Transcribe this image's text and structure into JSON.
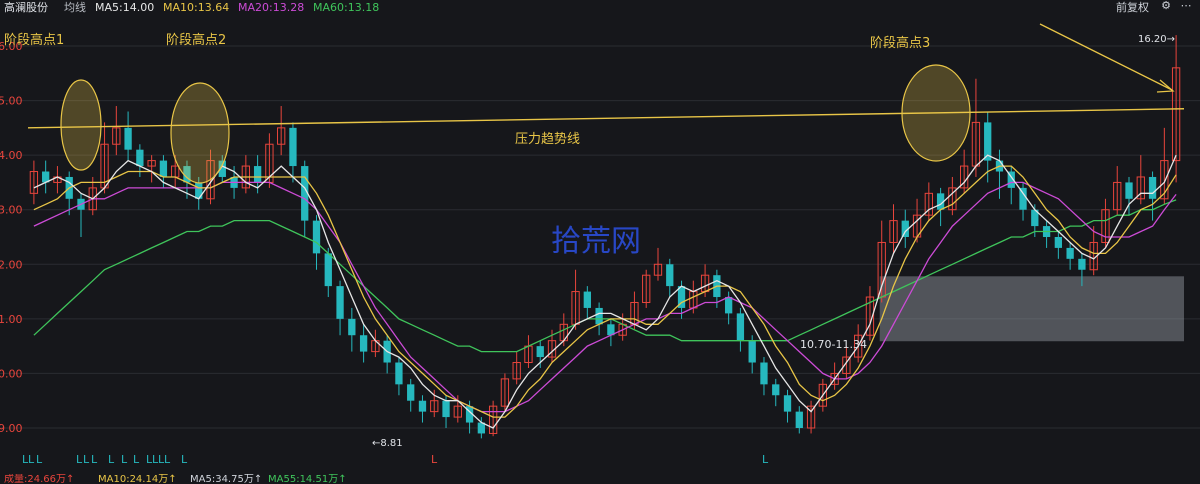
{
  "topbar": {
    "stock_name": "高澜股份",
    "avg_line": "均线",
    "ma5": "MA5:14.00",
    "ma10": "MA10:13.64",
    "ma20": "MA20:13.28",
    "ma60": "MA60:13.18",
    "adjust": "前复权"
  },
  "bottombar": {
    "vol": "成量:24.66万↑",
    "ma10v": "MA10:24.14万↑",
    "ma5v": "MA5:34.75万↑",
    "ma55v": "MA55:14.51万↑"
  },
  "colors": {
    "bg": "#16171b",
    "up": "#e8453c",
    "down": "#26b8be",
    "ma5": "#e6e6e6",
    "ma10": "#e8c547",
    "ma20": "#cc4bd6",
    "ma60": "#3fc45b",
    "trendline": "#e8c547",
    "watermark": "#2b4dd8"
  },
  "chart_data": {
    "type": "candlestick",
    "y_ticks": [
      "6.00",
      "5.00",
      "4.00",
      "3.00",
      "2.00",
      "1.00",
      "0.00",
      "9.00"
    ],
    "annotations": {
      "peak1": "阶段高点1",
      "peak2": "阶段高点2",
      "peak3": "阶段高点3",
      "trendline_label": "压力趋势线",
      "high_label": "16.20→",
      "low_label": "←8.81",
      "support_zone_label": "10.70-11.34",
      "watermark": "拾荒网"
    },
    "support_zone": [
      10.7,
      11.34
    ],
    "high": 16.2,
    "low": 8.81,
    "ma_lines": {
      "ma5": [
        13.4,
        13.5,
        13.6,
        13.5,
        13.3,
        13.2,
        13.4,
        13.7,
        13.9,
        13.8,
        13.7,
        13.5,
        13.4,
        13.3,
        13.2,
        13.5,
        13.8,
        13.7,
        13.5,
        13.4,
        13.6,
        13.8,
        13.6,
        13.4,
        13.0,
        12.4,
        11.9,
        11.4,
        10.9,
        10.6,
        10.4,
        10.3,
        10.1,
        9.8,
        9.6,
        9.5,
        9.5,
        9.3,
        9.1,
        9.0,
        9.3,
        9.7,
        10.0,
        10.2,
        10.4,
        10.6,
        10.9,
        11.0,
        11.1,
        11.1,
        11.0,
        10.9,
        10.8,
        11.0,
        11.4,
        11.6,
        11.5,
        11.6,
        11.7,
        11.6,
        11.3,
        10.9,
        10.5,
        10.1,
        9.8,
        9.5,
        9.3,
        9.6,
        9.9,
        10.2,
        10.5,
        10.9,
        11.6,
        12.2,
        12.6,
        12.8,
        13.0,
        13.1,
        13.3,
        13.5,
        13.8,
        14.0,
        13.9,
        13.6,
        13.3,
        13.0,
        12.8,
        12.6,
        12.4,
        12.2,
        12.1,
        12.3,
        12.7,
        13.1,
        13.3,
        13.3,
        13.5,
        14.0
      ],
      "ma10": [
        13.0,
        13.1,
        13.2,
        13.4,
        13.5,
        13.5,
        13.5,
        13.6,
        13.7,
        13.7,
        13.7,
        13.6,
        13.6,
        13.5,
        13.4,
        13.4,
        13.5,
        13.6,
        13.6,
        13.6,
        13.6,
        13.6,
        13.6,
        13.6,
        13.3,
        12.9,
        12.4,
        11.9,
        11.4,
        11.0,
        10.7,
        10.4,
        10.2,
        10.0,
        9.8,
        9.6,
        9.5,
        9.4,
        9.3,
        9.2,
        9.2,
        9.4,
        9.7,
        9.9,
        10.2,
        10.4,
        10.6,
        10.8,
        10.9,
        11.0,
        11.0,
        11.0,
        10.9,
        10.9,
        11.1,
        11.3,
        11.4,
        11.5,
        11.6,
        11.6,
        11.5,
        11.2,
        10.9,
        10.5,
        10.2,
        9.8,
        9.6,
        9.5,
        9.6,
        9.8,
        10.1,
        10.5,
        11.0,
        11.6,
        12.1,
        12.5,
        12.8,
        13.0,
        13.1,
        13.3,
        13.5,
        13.7,
        13.8,
        13.8,
        13.6,
        13.3,
        13.0,
        12.8,
        12.5,
        12.3,
        12.2,
        12.2,
        12.4,
        12.7,
        13.0,
        13.1,
        13.3,
        13.64
      ],
      "ma20": [
        12.7,
        12.8,
        12.9,
        13.0,
        13.1,
        13.2,
        13.2,
        13.3,
        13.4,
        13.4,
        13.4,
        13.4,
        13.4,
        13.4,
        13.4,
        13.4,
        13.5,
        13.5,
        13.5,
        13.5,
        13.5,
        13.4,
        13.3,
        13.2,
        13.0,
        12.7,
        12.4,
        12.0,
        11.6,
        11.2,
        10.9,
        10.6,
        10.3,
        10.1,
        9.9,
        9.7,
        9.5,
        9.4,
        9.3,
        9.3,
        9.3,
        9.4,
        9.5,
        9.7,
        9.9,
        10.1,
        10.3,
        10.5,
        10.6,
        10.7,
        10.8,
        10.9,
        11.0,
        11.0,
        11.1,
        11.1,
        11.2,
        11.3,
        11.3,
        11.4,
        11.3,
        11.2,
        11.0,
        10.8,
        10.6,
        10.4,
        10.2,
        10.0,
        9.9,
        9.9,
        10.0,
        10.2,
        10.5,
        10.9,
        11.3,
        11.7,
        12.1,
        12.4,
        12.7,
        12.9,
        13.1,
        13.3,
        13.4,
        13.5,
        13.5,
        13.4,
        13.3,
        13.2,
        13.0,
        12.8,
        12.6,
        12.5,
        12.5,
        12.5,
        12.6,
        12.7,
        13.0,
        13.28
      ],
      "ma60": [
        10.7,
        10.9,
        11.1,
        11.3,
        11.5,
        11.7,
        11.9,
        12.0,
        12.1,
        12.2,
        12.3,
        12.4,
        12.5,
        12.6,
        12.6,
        12.7,
        12.7,
        12.8,
        12.8,
        12.8,
        12.8,
        12.7,
        12.6,
        12.5,
        12.4,
        12.2,
        12.0,
        11.8,
        11.6,
        11.4,
        11.2,
        11.0,
        10.9,
        10.8,
        10.7,
        10.6,
        10.5,
        10.5,
        10.4,
        10.4,
        10.4,
        10.4,
        10.5,
        10.6,
        10.7,
        10.8,
        10.9,
        11.0,
        11.0,
        11.0,
        10.9,
        10.8,
        10.7,
        10.7,
        10.7,
        10.6,
        10.6,
        10.6,
        10.6,
        10.6,
        10.6,
        10.6,
        10.6,
        10.6,
        10.6,
        10.7,
        10.8,
        10.9,
        11.0,
        11.1,
        11.2,
        11.3,
        11.4,
        11.5,
        11.6,
        11.7,
        11.8,
        11.9,
        12.0,
        12.1,
        12.2,
        12.3,
        12.4,
        12.5,
        12.5,
        12.6,
        12.6,
        12.6,
        12.7,
        12.7,
        12.8,
        12.8,
        12.9,
        12.9,
        13.0,
        13.0,
        13.1,
        13.18
      ]
    },
    "candles": [
      [
        13.3,
        13.7,
        13.9,
        13.1
      ],
      [
        13.7,
        13.5,
        13.9,
        13.3
      ],
      [
        13.5,
        13.6,
        13.8,
        13.3
      ],
      [
        13.6,
        13.2,
        13.7,
        12.9
      ],
      [
        13.2,
        13.0,
        13.3,
        12.5
      ],
      [
        13.0,
        13.4,
        13.6,
        12.9
      ],
      [
        13.4,
        14.2,
        14.6,
        13.3
      ],
      [
        14.2,
        14.5,
        14.9,
        14.0
      ],
      [
        14.5,
        14.1,
        14.8,
        13.9
      ],
      [
        14.1,
        13.8,
        14.2,
        13.6
      ],
      [
        13.8,
        13.9,
        14.0,
        13.5
      ],
      [
        13.9,
        13.6,
        14.0,
        13.4
      ],
      [
        13.6,
        13.8,
        14.0,
        13.4
      ],
      [
        13.8,
        13.5,
        13.9,
        13.2
      ],
      [
        13.5,
        13.2,
        13.6,
        13.0
      ],
      [
        13.2,
        13.9,
        14.1,
        13.1
      ],
      [
        13.9,
        13.6,
        14.0,
        13.5
      ],
      [
        13.6,
        13.4,
        13.8,
        13.2
      ],
      [
        13.4,
        13.8,
        14.0,
        13.3
      ],
      [
        13.8,
        13.5,
        14.0,
        13.3
      ],
      [
        13.5,
        14.2,
        14.4,
        13.4
      ],
      [
        14.2,
        14.5,
        14.9,
        14.0
      ],
      [
        14.5,
        13.8,
        14.6,
        13.5
      ],
      [
        13.8,
        12.8,
        13.9,
        12.5
      ],
      [
        12.8,
        12.2,
        12.9,
        11.9
      ],
      [
        12.2,
        11.6,
        12.3,
        11.4
      ],
      [
        11.6,
        11.0,
        11.7,
        10.7
      ],
      [
        11.0,
        10.7,
        11.2,
        10.4
      ],
      [
        10.7,
        10.4,
        10.9,
        10.2
      ],
      [
        10.4,
        10.6,
        10.8,
        10.3
      ],
      [
        10.6,
        10.2,
        10.7,
        10.0
      ],
      [
        10.2,
        9.8,
        10.3,
        9.6
      ],
      [
        9.8,
        9.5,
        9.9,
        9.3
      ],
      [
        9.5,
        9.3,
        9.6,
        9.1
      ],
      [
        9.3,
        9.5,
        9.7,
        9.2
      ],
      [
        9.5,
        9.2,
        9.6,
        9.0
      ],
      [
        9.2,
        9.4,
        9.6,
        9.1
      ],
      [
        9.4,
        9.1,
        9.5,
        8.9
      ],
      [
        9.1,
        8.9,
        9.2,
        8.81
      ],
      [
        8.9,
        9.4,
        9.5,
        8.85
      ],
      [
        9.4,
        9.9,
        10.0,
        9.3
      ],
      [
        9.9,
        10.2,
        10.4,
        9.8
      ],
      [
        10.2,
        10.5,
        10.7,
        10.1
      ],
      [
        10.5,
        10.3,
        10.6,
        10.1
      ],
      [
        10.3,
        10.6,
        10.8,
        10.2
      ],
      [
        10.6,
        10.9,
        11.1,
        10.5
      ],
      [
        10.9,
        11.5,
        11.9,
        10.8
      ],
      [
        11.5,
        11.2,
        11.6,
        11.0
      ],
      [
        11.2,
        10.9,
        11.3,
        10.7
      ],
      [
        10.9,
        10.7,
        11.0,
        10.5
      ],
      [
        10.7,
        10.9,
        11.1,
        10.6
      ],
      [
        10.9,
        11.3,
        11.5,
        10.8
      ],
      [
        11.3,
        11.8,
        11.9,
        11.2
      ],
      [
        11.8,
        12.0,
        12.3,
        11.7
      ],
      [
        12.0,
        11.6,
        12.1,
        11.4
      ],
      [
        11.6,
        11.2,
        11.7,
        11.0
      ],
      [
        11.2,
        11.5,
        11.7,
        11.1
      ],
      [
        11.5,
        11.8,
        12.0,
        11.4
      ],
      [
        11.8,
        11.4,
        11.9,
        11.2
      ],
      [
        11.4,
        11.1,
        11.5,
        10.9
      ],
      [
        11.1,
        10.6,
        11.2,
        10.4
      ],
      [
        10.6,
        10.2,
        10.7,
        10.0
      ],
      [
        10.2,
        9.8,
        10.3,
        9.6
      ],
      [
        9.8,
        9.6,
        9.9,
        9.4
      ],
      [
        9.6,
        9.3,
        9.7,
        9.1
      ],
      [
        9.3,
        9.0,
        9.4,
        8.9
      ],
      [
        9.0,
        9.4,
        9.5,
        8.9
      ],
      [
        9.4,
        9.8,
        9.9,
        9.3
      ],
      [
        9.8,
        10.0,
        10.2,
        9.7
      ],
      [
        10.0,
        10.3,
        10.5,
        9.9
      ],
      [
        10.3,
        10.7,
        10.9,
        10.2
      ],
      [
        10.7,
        11.4,
        11.6,
        10.6
      ],
      [
        11.4,
        12.4,
        12.8,
        11.3
      ],
      [
        12.4,
        12.8,
        13.1,
        12.2
      ],
      [
        12.8,
        12.5,
        13.0,
        12.3
      ],
      [
        12.5,
        12.9,
        13.2,
        12.4
      ],
      [
        12.9,
        13.3,
        13.5,
        12.8
      ],
      [
        13.3,
        13.0,
        13.4,
        12.7
      ],
      [
        13.0,
        13.4,
        13.6,
        12.9
      ],
      [
        13.4,
        13.8,
        14.1,
        13.3
      ],
      [
        13.8,
        14.6,
        15.4,
        13.6
      ],
      [
        14.6,
        13.9,
        14.8,
        13.5
      ],
      [
        13.9,
        13.7,
        14.1,
        13.2
      ],
      [
        13.7,
        13.4,
        13.8,
        13.1
      ],
      [
        13.4,
        13.0,
        13.5,
        12.8
      ],
      [
        13.0,
        12.7,
        13.1,
        12.5
      ],
      [
        12.7,
        12.5,
        12.8,
        12.3
      ],
      [
        12.5,
        12.3,
        12.6,
        12.1
      ],
      [
        12.3,
        12.1,
        12.4,
        11.9
      ],
      [
        12.1,
        11.9,
        12.2,
        11.6
      ],
      [
        11.9,
        12.4,
        12.7,
        11.8
      ],
      [
        12.4,
        13.0,
        13.2,
        12.3
      ],
      [
        13.0,
        13.5,
        13.8,
        12.9
      ],
      [
        13.5,
        13.2,
        13.6,
        12.9
      ],
      [
        13.2,
        13.6,
        14.0,
        13.1
      ],
      [
        13.6,
        13.2,
        13.7,
        12.8
      ],
      [
        13.2,
        13.9,
        14.5,
        13.1
      ],
      [
        13.9,
        15.6,
        16.2,
        13.5
      ]
    ]
  }
}
